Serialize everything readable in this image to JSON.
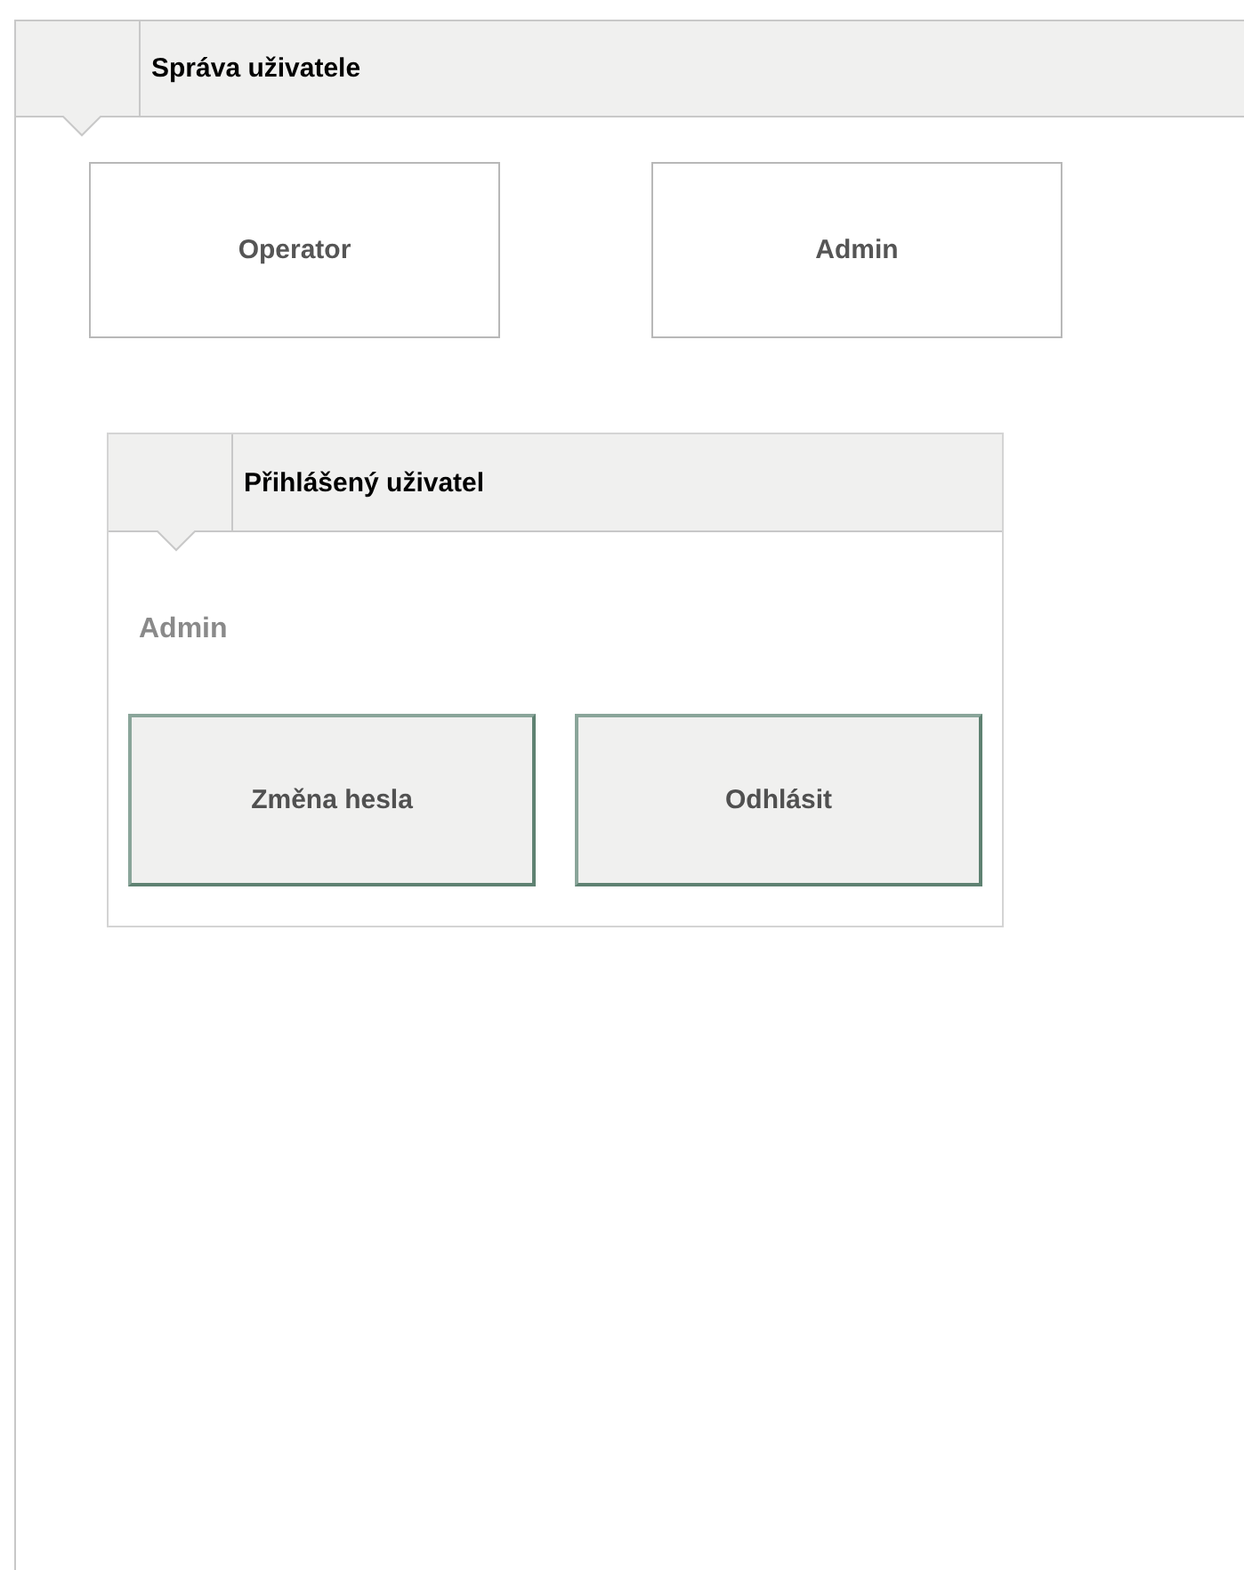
{
  "panel": {
    "title": "Správa uživatele"
  },
  "roles": [
    {
      "label": "Operator"
    },
    {
      "label": "Admin"
    }
  ],
  "logged_in": {
    "title": "Přihlášený uživatel",
    "user": "Admin",
    "buttons": [
      {
        "label": "Změna hesla"
      },
      {
        "label": "Odhlásit"
      }
    ]
  }
}
